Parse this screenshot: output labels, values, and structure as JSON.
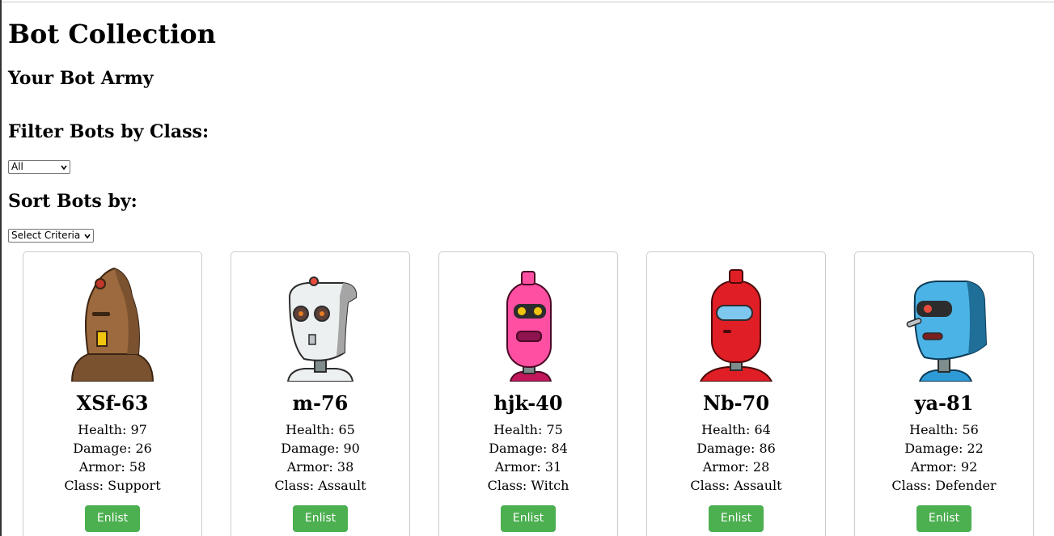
{
  "page": {
    "title": "Bot Collection",
    "army_heading": "Your Bot Army",
    "filter_heading": "Filter Bots by Class:",
    "filter_selected": "All",
    "sort_heading": "Sort Bots by:",
    "sort_selected": "Select Criteria"
  },
  "colors": {
    "button_bg": "#4caf50",
    "button_text": "#ffffff",
    "card_border": "#cccccc"
  },
  "bots": [
    {
      "name": "XSf-63",
      "health": "Health: 97",
      "damage": "Damage: 26",
      "armor": "Armor: 58",
      "class": "Class: Support",
      "button": "Enlist"
    },
    {
      "name": "m-76",
      "health": "Health: 65",
      "damage": "Damage: 90",
      "armor": "Armor: 38",
      "class": "Class: Assault",
      "button": "Enlist"
    },
    {
      "name": "hjk-40",
      "health": "Health: 75",
      "damage": "Damage: 84",
      "armor": "Armor: 31",
      "class": "Class: Witch",
      "button": "Enlist"
    },
    {
      "name": "Nb-70",
      "health": "Health: 64",
      "damage": "Damage: 86",
      "armor": "Armor: 28",
      "class": "Class: Assault",
      "button": "Enlist"
    },
    {
      "name": "ya-81",
      "health": "Health: 56",
      "damage": "Damage: 22",
      "armor": "Armor: 92",
      "class": "Class: Defender",
      "button": "Enlist"
    }
  ]
}
